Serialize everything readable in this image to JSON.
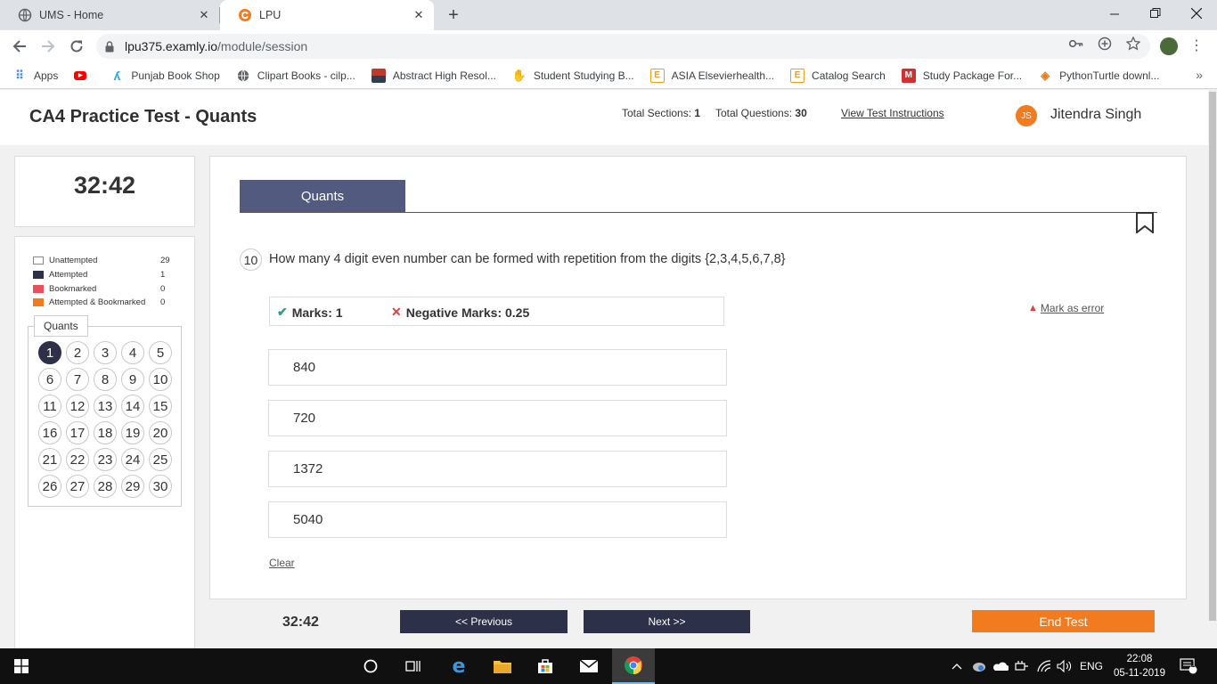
{
  "browser": {
    "tabs": [
      {
        "title": "UMS - Home",
        "active": false
      },
      {
        "title": "LPU",
        "active": true
      }
    ],
    "url_host": "lpu375.examly.io",
    "url_path": "/module/session",
    "bookmarks": [
      {
        "label": "Apps",
        "icon": "apps-grid-icon",
        "color": "#4285f4"
      },
      {
        "label": "",
        "icon": "youtube-icon",
        "color": "#ff0000"
      },
      {
        "label": "Punjab Book Shop",
        "icon": "punjab-book-shop-icon",
        "color": "#29a8e0"
      },
      {
        "label": "Clipart Books - cilp...",
        "icon": "globe-icon",
        "color": "#5f6368"
      },
      {
        "label": "Abstract High Resol...",
        "icon": "abstract-icon",
        "color": "#c0392b"
      },
      {
        "label": "Student Studying B...",
        "icon": "student-icon",
        "color": "#f5b041"
      },
      {
        "label": "ASIA Elsevierhealth...",
        "icon": "elsevier-icon",
        "color": "#f39c12"
      },
      {
        "label": "Catalog Search",
        "icon": "catalog-icon",
        "color": "#f39c12"
      },
      {
        "label": "Study Package For...",
        "icon": "study-package-icon",
        "color": "#d32f2f"
      },
      {
        "label": "PythonTurtle downl...",
        "icon": "python-turtle-icon",
        "color": "#e67e22"
      }
    ]
  },
  "header": {
    "title": "CA4 Practice Test - Quants",
    "total_sections_label": "Total Sections:",
    "total_sections": "1",
    "total_questions_label": "Total Questions:",
    "total_questions": "30",
    "instructions_link": "View Test Instructions",
    "user_initials": "JS",
    "user_name": "Jitendra Singh"
  },
  "timer": "32:42",
  "legend": [
    {
      "label": "Unattempted",
      "count": "29",
      "color": "#ffffff"
    },
    {
      "label": "Attempted",
      "count": "1",
      "color": "#2d3049"
    },
    {
      "label": "Bookmarked",
      "count": "0",
      "color": "#e8505b"
    },
    {
      "label": "Attempted & Bookmarked",
      "count": "0",
      "color": "#f27b1f"
    }
  ],
  "section_tab": "Quants",
  "question_grid_label": "Quants",
  "question_numbers": [
    "1",
    "2",
    "3",
    "4",
    "5",
    "6",
    "7",
    "8",
    "9",
    "10",
    "11",
    "12",
    "13",
    "14",
    "15",
    "16",
    "17",
    "18",
    "19",
    "20",
    "21",
    "22",
    "23",
    "24",
    "25",
    "26",
    "27",
    "28",
    "29",
    "30"
  ],
  "current_grid_question": "1",
  "question": {
    "number": "10",
    "text": "How many 4 digit even number can be formed with repetition from the digits {2,3,4,5,6,7,8}",
    "marks": "Marks: 1",
    "negative_marks": "Negative Marks: 0.25",
    "mark_error": "Mark as error",
    "options": [
      "840",
      "720",
      "1372",
      "5040"
    ],
    "clear": "Clear"
  },
  "footer": {
    "timer": "32:42",
    "previous": "<< Previous",
    "next": "Next >>",
    "end": "End Test"
  },
  "taskbar": {
    "language": "ENG",
    "time": "22:08",
    "date": "05-11-2019",
    "notification_count": "1"
  }
}
